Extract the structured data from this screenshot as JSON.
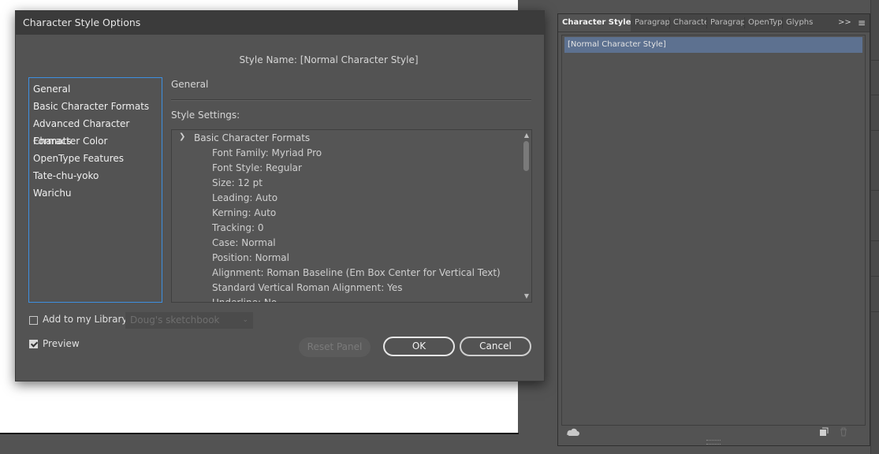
{
  "dialog": {
    "title": "Character Style Options",
    "style_name_label": "Style Name:",
    "style_name_value": "[Normal Character Style]",
    "categories": [
      "General",
      "Basic Character Formats",
      "Advanced Character Formats",
      "Character Color",
      "OpenType Features",
      "Tate-chu-yoko",
      "Warichu"
    ],
    "section_heading": "General",
    "style_settings_label": "Style Settings:",
    "settings_group": "Basic Character Formats",
    "settings_lines": [
      "Font Family: Myriad Pro",
      "Font Style: Regular",
      "Size: 12 pt",
      "Leading: Auto",
      "Kerning: Auto",
      "Tracking: 0",
      "Case: Normal",
      "Position: Normal",
      "Alignment: Roman Baseline (Em Box Center for Vertical Text)",
      "Standard Vertical Roman Alignment: Yes",
      "Underline: No"
    ],
    "add_to_library_label": "Add to my Library",
    "add_to_library_checked": false,
    "library_select_value": "Doug's sketchbook",
    "preview_label": "Preview",
    "preview_checked": true,
    "buttons": {
      "reset": "Reset Panel",
      "ok": "OK",
      "cancel": "Cancel"
    }
  },
  "panel": {
    "tabs": [
      "Character Styles",
      "Paragrap",
      "Characte",
      "Paragrap",
      "OpenTyp",
      "Glyphs"
    ],
    "active_tab": "Character Styles",
    "expand_icon": ">>",
    "selected_style": "[Normal Character Style]",
    "footer_icons": [
      "cloud-icon",
      "new-style-icon",
      "trash-icon"
    ]
  },
  "colors": {
    "dialog_bg": "#535353",
    "titlebar_bg": "#3b3b3b",
    "list_focus_border": "#3d8fe0",
    "selected_row": "#5d7190"
  }
}
